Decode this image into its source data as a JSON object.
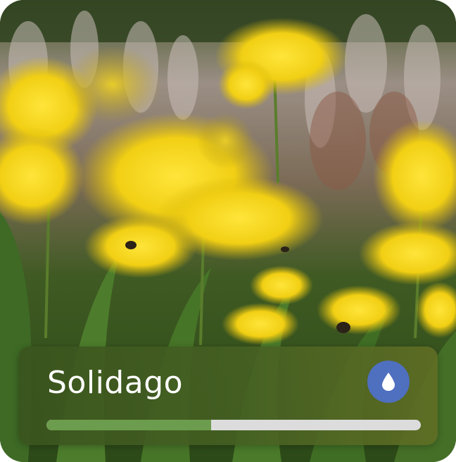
{
  "card": {
    "plant_name": "Solidago",
    "image_subject": "goldenrod-flowers-photo",
    "water_button": {
      "icon": "water-drop-icon",
      "color": "#4f6fbf"
    },
    "moisture_progress": {
      "fraction": 0.44,
      "fill_color": "#6c9c4d",
      "track_color": "#dcdcdc"
    }
  }
}
